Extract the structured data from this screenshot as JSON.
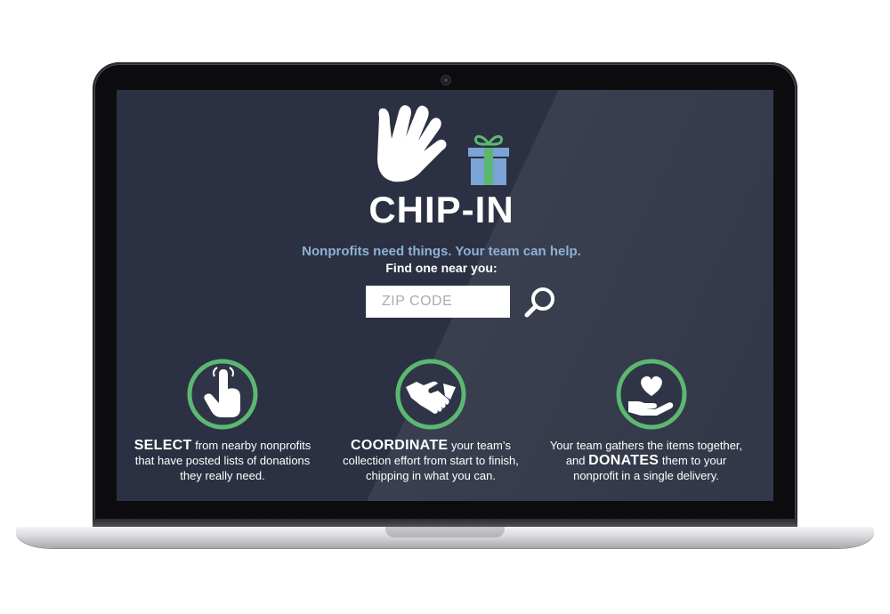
{
  "hero": {
    "brand": "CHIP-IN",
    "tagline": "Nonprofits need things. Your team can help.",
    "prompt": "Find one near you:"
  },
  "search": {
    "placeholder": "ZIP CODE",
    "value": ""
  },
  "features": [
    {
      "icon": "pointing-hand-icon",
      "pre": "",
      "bold": "SELECT",
      "post": " from nearby nonprofits that have posted lists of donations they really need."
    },
    {
      "icon": "handshake-icon",
      "pre": "",
      "bold": "COORDINATE",
      "post": " your team’s collection effort from start to finish, chipping in what you can."
    },
    {
      "icon": "heart-in-hand-icon",
      "pre": "Your team gathers the items together, and ",
      "bold": "DONATES",
      "post": " them to your nonprofit in a single delivery."
    }
  ],
  "colors": {
    "screen_bg": "#2b3142",
    "accent_green": "#5cb871",
    "tagline_blue": "#8eb1d6",
    "gift_blue": "#7ca3d6"
  }
}
